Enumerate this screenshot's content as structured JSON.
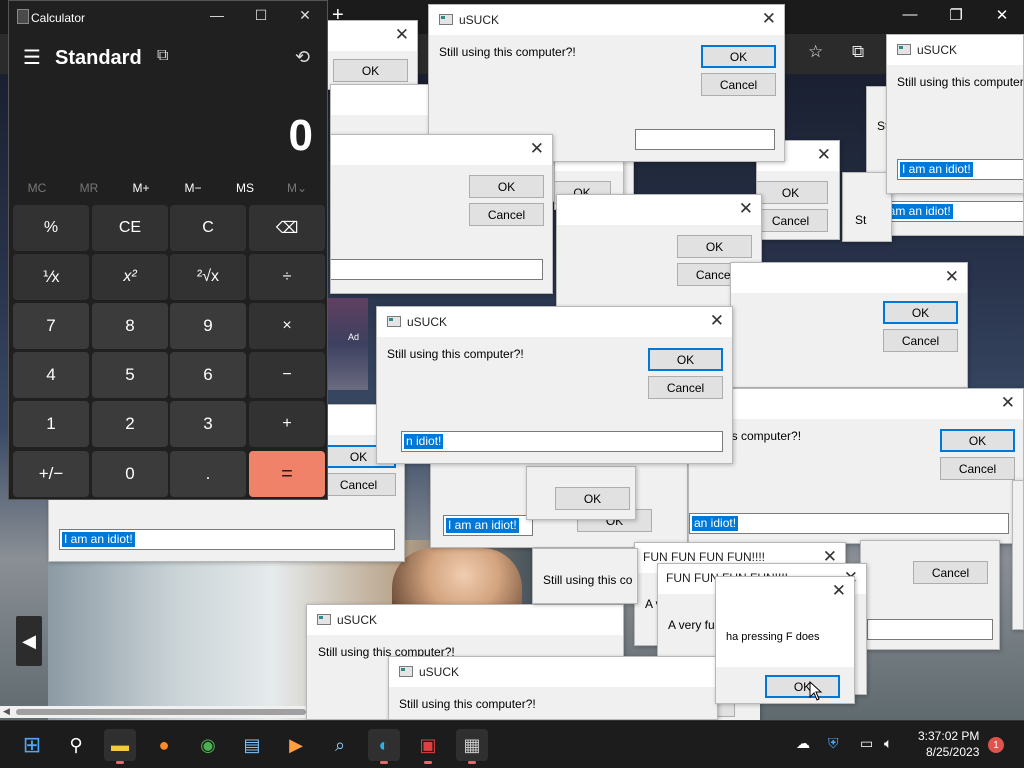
{
  "browser": {
    "newtab": "+",
    "minimize": "—",
    "restore": "❐",
    "close": "✕",
    "ad_label": "Ad",
    "back_arrow": "◀"
  },
  "calculator": {
    "title": "Calculator",
    "mode": "Standard",
    "display": "0",
    "memory": [
      "MC",
      "MR",
      "M+",
      "M−",
      "MS",
      "M⌄"
    ],
    "keys": [
      [
        "%",
        "CE",
        "C",
        "⌫"
      ],
      [
        "⅟x",
        "x²",
        "²√x",
        "÷"
      ],
      [
        "7",
        "8",
        "9",
        "×"
      ],
      [
        "4",
        "5",
        "6",
        "−"
      ],
      [
        "1",
        "2",
        "3",
        "+"
      ],
      [
        "+/−",
        "0",
        ".",
        "="
      ]
    ]
  },
  "dialogs": {
    "app_title": "uSUCK",
    "fun_title": "FUN FUN FUN FUN!!!!",
    "message": "Still using this computer?!",
    "message_clip_st": "St",
    "message_clip_is": "is computer?!",
    "message_clip_still": "Still using this co",
    "fun_message_clip": "A very fu",
    "fun_message_clip_s": "S",
    "ok": "OK",
    "cancel": "Cancel",
    "field_value": "I am an idiot!",
    "field_value_clip": "n idiot!",
    "field_value_clip2": "an idiot!",
    "front_message": "ha pressing F does",
    "close": "✕"
  },
  "taskbar": {
    "time": "3:37:02 PM",
    "date": "8/25/2023",
    "notifications": "1"
  }
}
